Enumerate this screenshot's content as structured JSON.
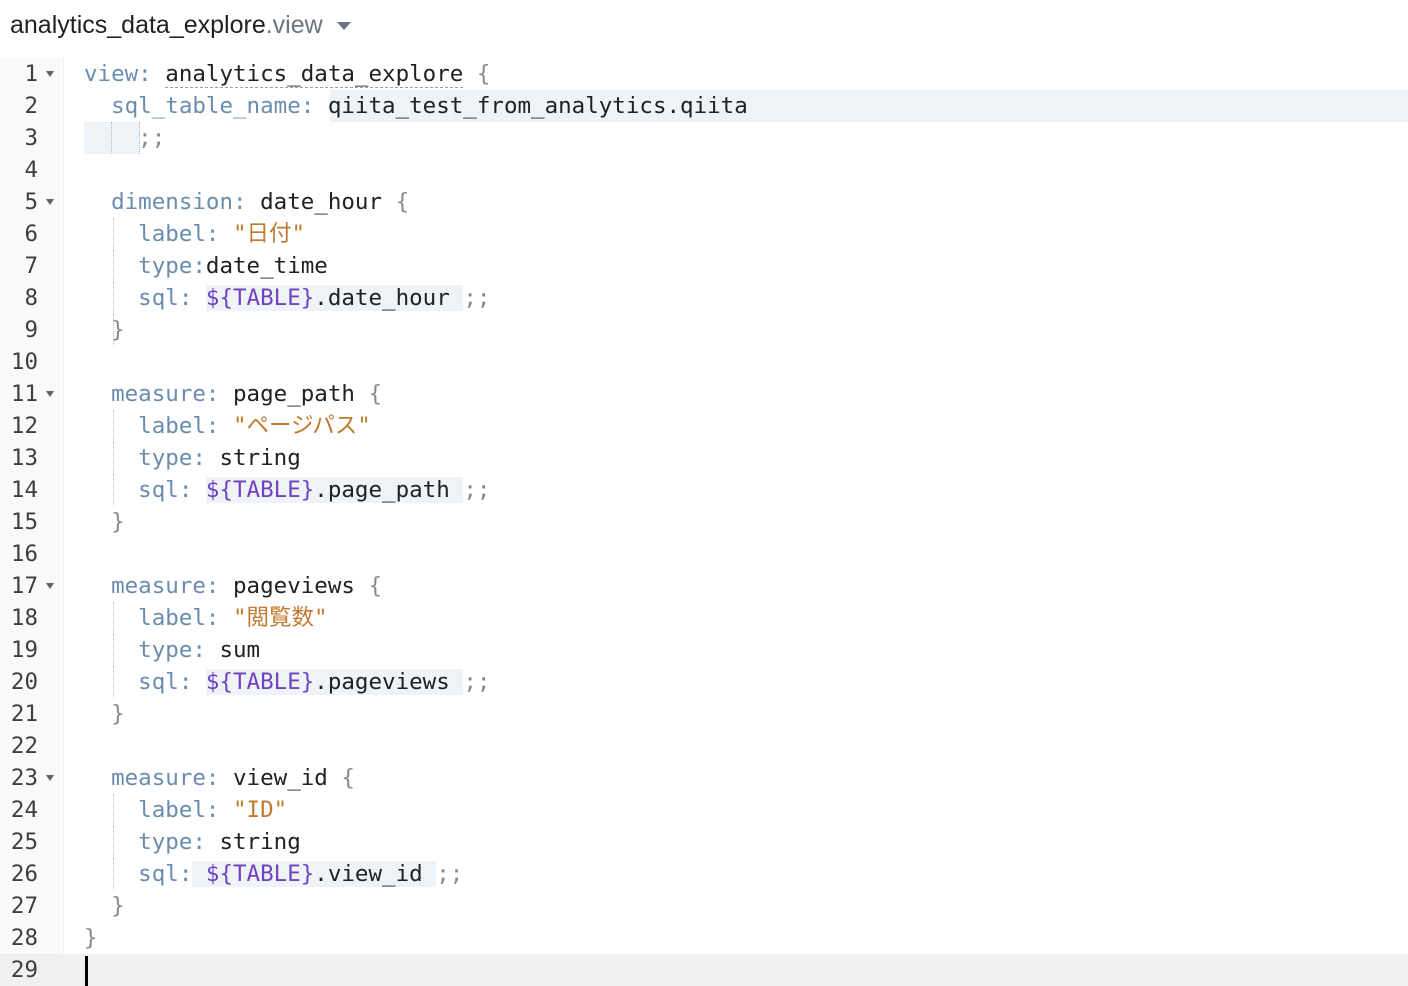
{
  "file": {
    "name": "analytics_data_explore",
    "ext": ".view"
  },
  "lines": [
    {
      "n": "1",
      "fold": true,
      "parts": [
        {
          "t": "view: ",
          "c": "k"
        },
        {
          "t": "analytics_data_explore",
          "c": "dashu"
        },
        {
          "t": " {",
          "c": "p"
        }
      ]
    },
    {
      "n": "2",
      "fold": false,
      "parts": [
        {
          "t": "  sql_table_name:",
          "c": "k"
        },
        {
          "t": " qiita_test_from_analytics.qiita",
          "c": ""
        }
      ]
    },
    {
      "n": "3",
      "fold": false,
      "parts": [
        {
          "t": "  ",
          "c": ""
        },
        {
          "t": "  ;;",
          "c": "p"
        }
      ]
    },
    {
      "n": "4",
      "fold": false,
      "parts": []
    },
    {
      "n": "5",
      "fold": true,
      "parts": [
        {
          "t": "  dimension: ",
          "c": "k"
        },
        {
          "t": "date_hour",
          "c": ""
        },
        {
          "t": " {",
          "c": "p"
        }
      ]
    },
    {
      "n": "6",
      "fold": false,
      "parts": [
        {
          "t": "    label: ",
          "c": "k"
        },
        {
          "t": "\"日付\"",
          "c": "s"
        }
      ]
    },
    {
      "n": "7",
      "fold": false,
      "parts": [
        {
          "t": "    type:",
          "c": "k"
        },
        {
          "t": "date_time",
          "c": ""
        }
      ]
    },
    {
      "n": "8",
      "fold": false,
      "parts": [
        {
          "t": "    sql: ",
          "c": "k"
        },
        {
          "t": "${TABLE}",
          "c": "v sqlbg"
        },
        {
          "t": ".date_hour ",
          "c": "sqlbg"
        },
        {
          "t": ";;",
          "c": "p"
        }
      ]
    },
    {
      "n": "9",
      "fold": false,
      "parts": [
        {
          "t": "  }",
          "c": "p"
        }
      ]
    },
    {
      "n": "10",
      "fold": false,
      "parts": []
    },
    {
      "n": "11",
      "fold": true,
      "parts": [
        {
          "t": "  measure: ",
          "c": "k"
        },
        {
          "t": "page_path",
          "c": ""
        },
        {
          "t": " {",
          "c": "p"
        }
      ]
    },
    {
      "n": "12",
      "fold": false,
      "parts": [
        {
          "t": "    label: ",
          "c": "k"
        },
        {
          "t": "\"ページパス\"",
          "c": "s"
        }
      ]
    },
    {
      "n": "13",
      "fold": false,
      "parts": [
        {
          "t": "    type: ",
          "c": "k"
        },
        {
          "t": "string",
          "c": ""
        }
      ]
    },
    {
      "n": "14",
      "fold": false,
      "parts": [
        {
          "t": "    sql: ",
          "c": "k"
        },
        {
          "t": "${TABLE}",
          "c": "v sqlbg"
        },
        {
          "t": ".page_path ",
          "c": "sqlbg"
        },
        {
          "t": ";;",
          "c": "p"
        }
      ]
    },
    {
      "n": "15",
      "fold": false,
      "parts": [
        {
          "t": "  }",
          "c": "p"
        }
      ]
    },
    {
      "n": "16",
      "fold": false,
      "parts": []
    },
    {
      "n": "17",
      "fold": true,
      "parts": [
        {
          "t": "  measure: ",
          "c": "k"
        },
        {
          "t": "pageviews",
          "c": ""
        },
        {
          "t": " {",
          "c": "p"
        }
      ]
    },
    {
      "n": "18",
      "fold": false,
      "parts": [
        {
          "t": "    label: ",
          "c": "k"
        },
        {
          "t": "\"閲覧数\"",
          "c": "s"
        }
      ]
    },
    {
      "n": "19",
      "fold": false,
      "parts": [
        {
          "t": "    type: ",
          "c": "k"
        },
        {
          "t": "sum",
          "c": ""
        }
      ]
    },
    {
      "n": "20",
      "fold": false,
      "parts": [
        {
          "t": "    sql: ",
          "c": "k"
        },
        {
          "t": "${TABLE}",
          "c": "v sqlbg"
        },
        {
          "t": ".pageviews ",
          "c": "sqlbg"
        },
        {
          "t": ";;",
          "c": "p"
        }
      ]
    },
    {
      "n": "21",
      "fold": false,
      "parts": [
        {
          "t": "  }",
          "c": "p"
        }
      ]
    },
    {
      "n": "22",
      "fold": false,
      "parts": []
    },
    {
      "n": "23",
      "fold": true,
      "parts": [
        {
          "t": "  measure: ",
          "c": "k"
        },
        {
          "t": "view_id",
          "c": ""
        },
        {
          "t": " {",
          "c": "p"
        }
      ]
    },
    {
      "n": "24",
      "fold": false,
      "parts": [
        {
          "t": "    label: ",
          "c": "k"
        },
        {
          "t": "\"ID\"",
          "c": "s"
        }
      ]
    },
    {
      "n": "25",
      "fold": false,
      "parts": [
        {
          "t": "    type: ",
          "c": "k"
        },
        {
          "t": "string",
          "c": ""
        }
      ]
    },
    {
      "n": "26",
      "fold": false,
      "parts": [
        {
          "t": "    sql:",
          "c": "k"
        },
        {
          "t": " ${TABLE}",
          "c": "v sqlbg"
        },
        {
          "t": ".view_id ",
          "c": "sqlbg"
        },
        {
          "t": ";;",
          "c": "p"
        }
      ]
    },
    {
      "n": "27",
      "fold": false,
      "parts": [
        {
          "t": "  }",
          "c": "p"
        }
      ]
    },
    {
      "n": "28",
      "fold": false,
      "parts": [
        {
          "t": "}",
          "c": "p"
        }
      ]
    },
    {
      "n": "29",
      "fold": false,
      "parts": [],
      "active": true
    }
  ]
}
